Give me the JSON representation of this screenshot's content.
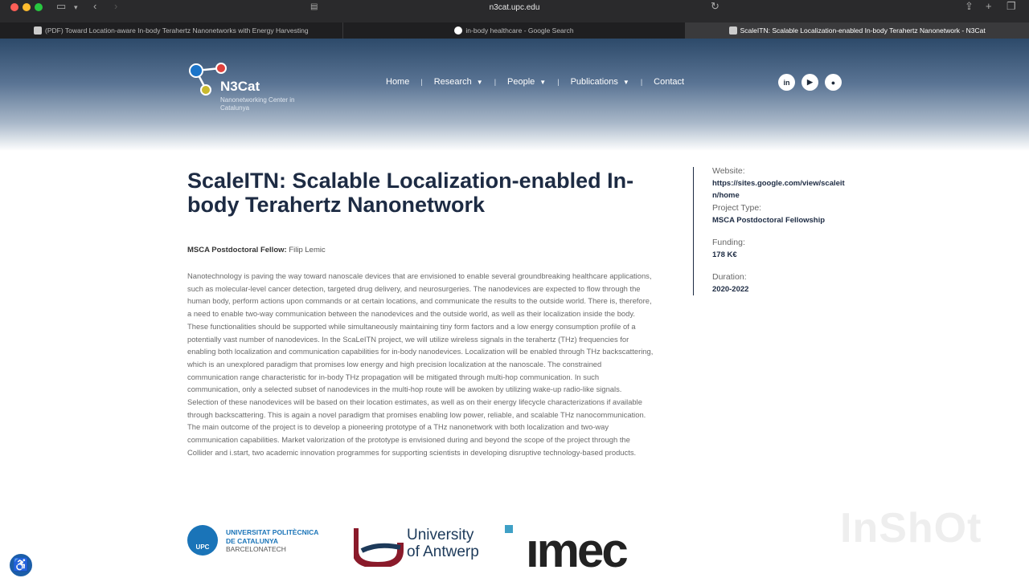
{
  "browser": {
    "address": "n3cat.upc.edu",
    "tabs": [
      {
        "label": "(PDF) Toward Location-aware In-body Terahertz Nanonetworks with Energy Harvesting",
        "active": false
      },
      {
        "label": "in-body healthcare - Google Search",
        "active": false
      },
      {
        "label": "ScaleITN: Scalable Localization-enabled In-body Terahertz Nanonetwork - N3Cat",
        "active": true
      }
    ]
  },
  "site": {
    "brand": "N3Cat",
    "subtitle": "Nanonetworking Center in Catalunya",
    "nav": [
      {
        "label": "Home",
        "dropdown": false
      },
      {
        "label": "Research",
        "dropdown": true
      },
      {
        "label": "People",
        "dropdown": true
      },
      {
        "label": "Publications",
        "dropdown": true
      },
      {
        "label": "Contact",
        "dropdown": false
      }
    ],
    "social": [
      "linkedin-icon",
      "youtube-icon",
      "github-icon"
    ]
  },
  "article": {
    "title": "ScaleITN: Scalable Localization-enabled In-body Terahertz Nanonetwork",
    "fellow_label": "MSCA Postdoctoral Fellow:",
    "fellow_name": "Filip Lemic",
    "body": "Nanotechnology is paving the way toward nanoscale devices that are envisioned to enable several groundbreaking healthcare applications, such as molecular-level cancer detection, targeted drug delivery, and neurosurgeries. The nanodevices are expected to flow through the human body, perform actions upon commands or at certain locations, and communicate the results to the outside world. There is, therefore, a need to enable two-way communication between the nanodevices and the outside world, as well as their localization inside the body. These functionalities should be supported while simultaneously maintaining tiny form factors and a low energy consumption profile of a potentially vast number of nanodevices. In the ScaLeITN project, we will utilize wireless signals in the terahertz (THz) frequencies for enabling both localization and communication capabilities for in-body nanodevices. Localization will be enabled through THz backscattering, which is an unexplored paradigm that promises low energy and high precision localization at the nanoscale. The constrained communication range characteristic for in-body THz propagation will be mitigated through multi-hop communication. In such communication, only a selected subset of nanodevices in the multi-hop route will be awoken by utilizing wake-up radio-like signals. Selection of these nanodevices will be based on their location estimates, as well as on their energy lifecycle characterizations if available through backscattering. This is again a novel paradigm that promises enabling low power, reliable, and scalable THz nanocommunication. The main outcome of the project is to develop a pioneering prototype of a THz nanonetwork with both localization and two-way communication capabilities. Market valorization of the prototype is envisioned during and beyond the scope of the project through the Collider and i.start, two academic innovation programmes for supporting scientists in developing disruptive technology-based products."
  },
  "sidebar": {
    "website_label": "Website:",
    "website_value": "https://sites.google.com/view/scaleitn/home",
    "type_label": "Project Type:",
    "type_value": "MSCA Postdoctoral Fellowship",
    "funding_label": "Funding:",
    "funding_value": "178 K€",
    "duration_label": "Duration:",
    "duration_value": "2020-2022"
  },
  "partners": {
    "upc_line1": "UNIVERSITAT POLITÈCNICA",
    "upc_line2": "DE CATALUNYA",
    "upc_line3": "BARCELONATECH",
    "upc_badge": "UPC",
    "antwerp_line1": "University",
    "antwerp_line2": "of Antwerp",
    "imec": "ımec"
  },
  "watermark": "InShOt"
}
